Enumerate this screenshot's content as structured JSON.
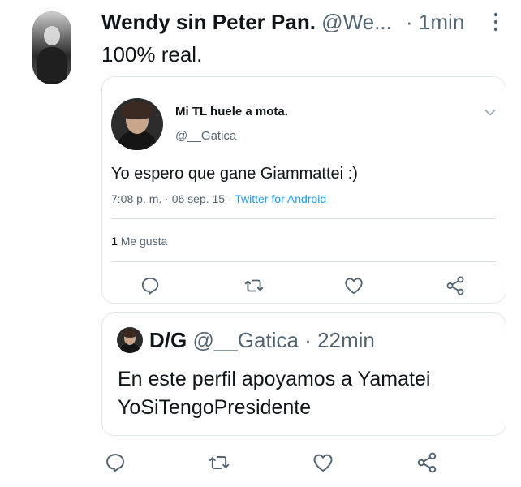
{
  "tweet": {
    "display_name": "Wendy sin Peter Pan.",
    "handle": "@We...",
    "separator": "·",
    "time": "1min",
    "text": "100% real."
  },
  "quoted_tweet": {
    "display_name": "Mi TL huele a mota.",
    "handle": "@__Gatica",
    "text": "Yo espero que gane Giammattei :)",
    "meta_prefix": "7:08 p. m. · 06 sep. 15 · ",
    "source": "Twitter for Android",
    "likes_count": "1",
    "likes_label": "Me gusta"
  },
  "quote_card": {
    "display_name": "D/G",
    "handle": "@__Gatica",
    "separator": "·",
    "time": "22min",
    "text": "En este perfil apoyamos a Yamatei YoSiTengoPresidente"
  },
  "icons": {
    "reply": "reply-icon",
    "retweet": "retweet-icon",
    "like": "heart-icon",
    "share": "share-icon",
    "more": "more-vertical-icon",
    "expand": "chevron-down-icon"
  },
  "colors": {
    "text": "#0f1419",
    "muted": "#536471",
    "link": "#1d9bf0",
    "border": "#e1e6ea"
  }
}
